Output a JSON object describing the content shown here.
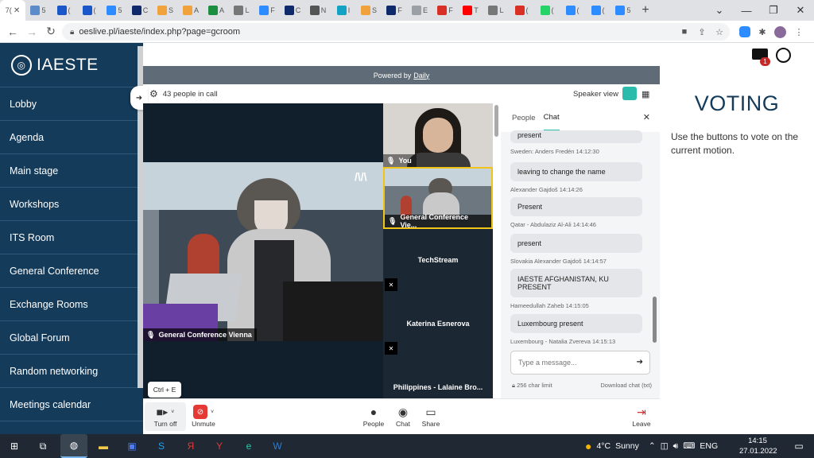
{
  "browser": {
    "active_tab_label": "7(",
    "tabs": [
      {
        "color": "#ffffff",
        "label": "7("
      },
      {
        "color": "#5b8cc9",
        "label": "5"
      },
      {
        "color": "#1a56c7",
        "label": "("
      },
      {
        "color": "#1a56c7",
        "label": "("
      },
      {
        "color": "#2d8cff",
        "label": "5"
      },
      {
        "color": "#0f2a6b",
        "label": "C"
      },
      {
        "color": "#f0a23c",
        "label": "S"
      },
      {
        "color": "#f0a23c",
        "label": "A"
      },
      {
        "color": "#1c8e3f",
        "label": "A"
      },
      {
        "color": "#777777",
        "label": "L"
      },
      {
        "color": "#2d8cff",
        "label": "F"
      },
      {
        "color": "#0f2a6b",
        "label": "C"
      },
      {
        "color": "#555555",
        "label": "N"
      },
      {
        "color": "#12a3c4",
        "label": "I"
      },
      {
        "color": "#f0a23c",
        "label": "S"
      },
      {
        "color": "#0f2a6b",
        "label": "F"
      },
      {
        "color": "#9aa0a6",
        "label": "E"
      },
      {
        "color": "#d93025",
        "label": "F"
      },
      {
        "color": "#ff0000",
        "label": "T"
      },
      {
        "color": "#777777",
        "label": "L"
      },
      {
        "color": "#d93025",
        "label": "("
      },
      {
        "color": "#25d366",
        "label": "("
      },
      {
        "color": "#2d8cff",
        "label": "("
      },
      {
        "color": "#2d8cff",
        "label": "("
      },
      {
        "color": "#2d8cff",
        "label": "5"
      }
    ],
    "new_tab": "+",
    "url": "oeslive.pl/iaeste/index.php?page=gcroom"
  },
  "sidebar": {
    "logo_text": "IAESTE",
    "items": [
      {
        "label": "Lobby"
      },
      {
        "label": "Agenda"
      },
      {
        "label": "Main stage"
      },
      {
        "label": "Workshops"
      },
      {
        "label": "ITS Room"
      },
      {
        "label": "General Conference"
      },
      {
        "label": "Exchange Rooms"
      },
      {
        "label": "Global Forum"
      },
      {
        "label": "Random networking"
      },
      {
        "label": "Meetings calendar"
      }
    ]
  },
  "header": {
    "mail_badge": "1"
  },
  "call": {
    "powered_by": "Powered by",
    "powered_by_link": "Daily",
    "people_count": "43 people in call",
    "speaker_view": "Speaker view",
    "main_label": "General Conference Vienna",
    "tiles": [
      {
        "name": "You"
      },
      {
        "name": "General Conference Vie..."
      },
      {
        "name": "TechStream"
      },
      {
        "name": "Katerina Esnerova"
      },
      {
        "name": "Philippines - Lalaine Bro..."
      }
    ]
  },
  "chat": {
    "tab_people": "People",
    "tab_chat": "Chat",
    "messages": [
      {
        "text": "present",
        "meta": "Sweden: Anders Fredén 14:12:30"
      },
      {
        "text": "leaving to change the name",
        "meta": "Alexander Gajdoš 14:14:26"
      },
      {
        "text": "Present",
        "meta": "Qatar - Abdulaziz Al-Ali 14:14:46"
      },
      {
        "text": "present",
        "meta": "Slovakia Alexander Gajdoš 14:14:57"
      },
      {
        "text": "IAESTE AFGHANISTAN, KU PRESENT",
        "meta": "Hameedullah Zaheb 14:15:05"
      },
      {
        "text": "Luxembourg present",
        "meta": "Luxembourg - Natalia Zvereva 14:15:13"
      }
    ],
    "input_placeholder": "Type a message...",
    "char_limit": "256 char limit",
    "download": "Download chat (txt)"
  },
  "tooltip": "Ctrl + E",
  "tray": {
    "turn_off": "Turn off",
    "unmute": "Unmute",
    "people": "People",
    "chat": "Chat",
    "share": "Share",
    "leave": "Leave"
  },
  "voting": {
    "title": "VOTING",
    "text": "Use the buttons to vote on the current motion."
  },
  "taskbar": {
    "weather_temp": "4°C",
    "weather_text": "Sunny",
    "lang": "ENG",
    "time": "14:15",
    "date": "27.01.2022"
  },
  "colors": {
    "sidebar_bg": "#143b5a",
    "accent": "#2bbbad",
    "voting_title": "#143b5a",
    "leave_red": "#d32f2f"
  }
}
